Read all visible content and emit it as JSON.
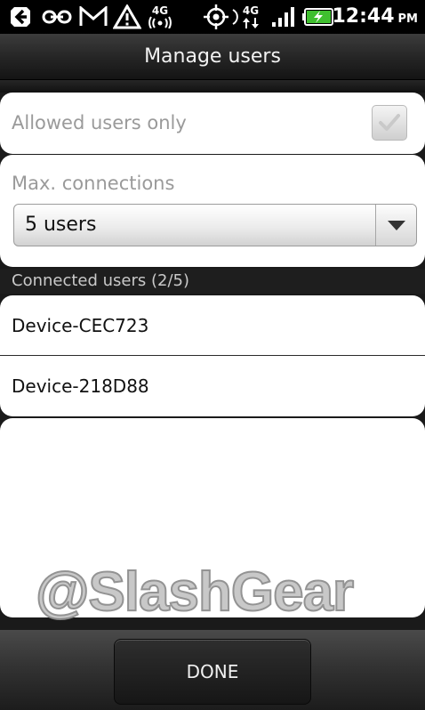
{
  "status_bar": {
    "time": "12:44",
    "ampm": "PM",
    "network_label_1": "4G",
    "network_label_2": "4G",
    "icons": [
      "usb-debug-icon",
      "tether-icon",
      "gmail-icon",
      "alert-icon",
      "wifi-hotspot-4g-icon",
      "gps-icon",
      "data-activity-icon",
      "signal-icon",
      "battery-charging-icon"
    ]
  },
  "title_bar": {
    "title": "Manage users"
  },
  "allowed_users": {
    "label": "Allowed users only",
    "checked": true
  },
  "max_connections": {
    "label": "Max. connections",
    "selected": "5 users"
  },
  "connected_users": {
    "header": "Connected users (2/5)",
    "items": [
      "Device-CEC723",
      "Device-218D88"
    ]
  },
  "watermark": "@SlashGear",
  "bottom_bar": {
    "done_label": "DONE"
  }
}
